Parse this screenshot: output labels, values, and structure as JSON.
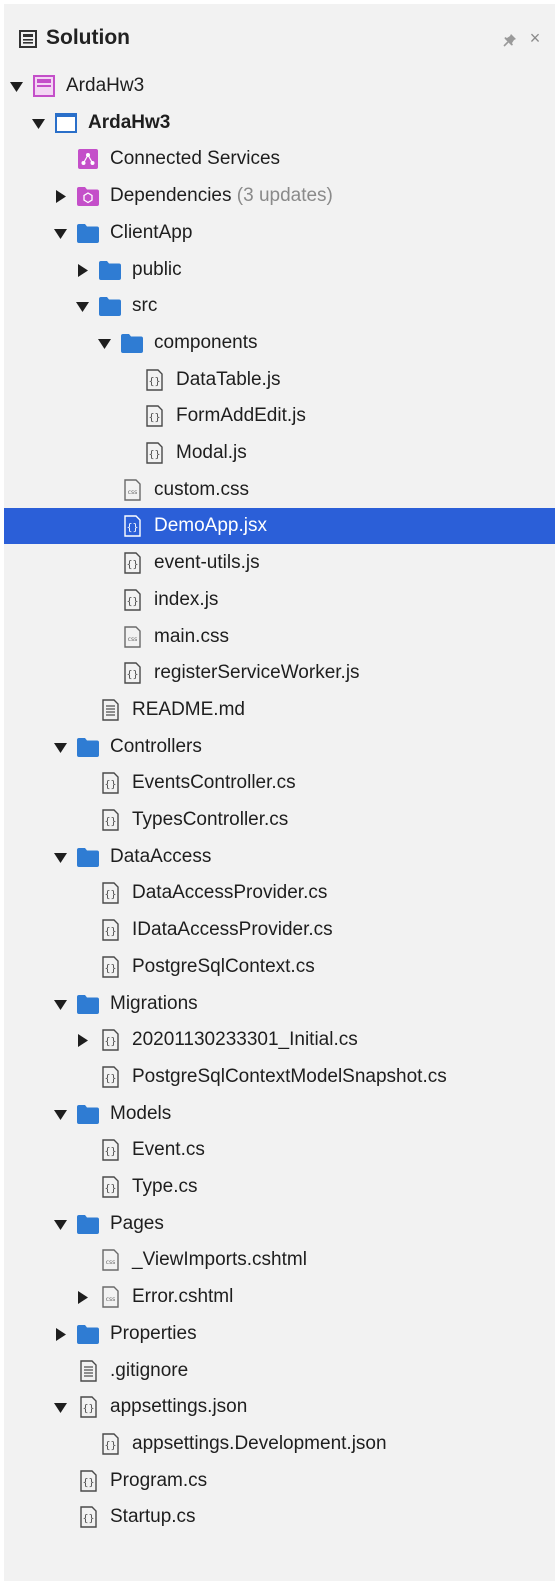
{
  "panel": {
    "title": "Solution",
    "pin_icon": "pin-icon",
    "close_icon": "close-icon",
    "close_glyph": "×"
  },
  "colors": {
    "panel_bg": "#f2f2f2",
    "selection": "#2b5fd8",
    "folder": "#2f7cd3",
    "project": "#c44fc9"
  },
  "tree": [
    {
      "label": "ArdaHw3",
      "icon": "solution",
      "depth": 0,
      "expanded": true,
      "has_children": true
    },
    {
      "label": "ArdaHw3",
      "icon": "project",
      "depth": 1,
      "expanded": true,
      "has_children": true,
      "bold": true
    },
    {
      "label": "Connected Services",
      "icon": "connected-services",
      "depth": 2,
      "has_children": false
    },
    {
      "label": "Dependencies",
      "suffix": "(3 updates)",
      "icon": "dependencies",
      "depth": 2,
      "expanded": false,
      "has_children": true
    },
    {
      "label": "ClientApp",
      "icon": "folder",
      "depth": 2,
      "expanded": true,
      "has_children": true
    },
    {
      "label": "public",
      "icon": "folder",
      "depth": 3,
      "expanded": false,
      "has_children": true
    },
    {
      "label": "src",
      "icon": "folder",
      "depth": 3,
      "expanded": true,
      "has_children": true
    },
    {
      "label": "components",
      "icon": "folder",
      "depth": 4,
      "expanded": true,
      "has_children": true
    },
    {
      "label": "DataTable.js",
      "icon": "code-file",
      "depth": 5,
      "has_children": false
    },
    {
      "label": "FormAddEdit.js",
      "icon": "code-file",
      "depth": 5,
      "has_children": false
    },
    {
      "label": "Modal.js",
      "icon": "code-file",
      "depth": 5,
      "has_children": false
    },
    {
      "label": "custom.css",
      "icon": "css-file",
      "depth": 4,
      "has_children": false
    },
    {
      "label": "DemoApp.jsx",
      "icon": "code-file",
      "depth": 4,
      "has_children": false,
      "selected": true
    },
    {
      "label": "event-utils.js",
      "icon": "code-file",
      "depth": 4,
      "has_children": false
    },
    {
      "label": "index.js",
      "icon": "code-file",
      "depth": 4,
      "has_children": false
    },
    {
      "label": "main.css",
      "icon": "css-file",
      "depth": 4,
      "has_children": false
    },
    {
      "label": "registerServiceWorker.js",
      "icon": "code-file",
      "depth": 4,
      "has_children": false
    },
    {
      "label": "README.md",
      "icon": "text-file",
      "depth": 3,
      "has_children": false
    },
    {
      "label": "Controllers",
      "icon": "folder",
      "depth": 2,
      "expanded": true,
      "has_children": true
    },
    {
      "label": "EventsController.cs",
      "icon": "code-file",
      "depth": 3,
      "has_children": false
    },
    {
      "label": "TypesController.cs",
      "icon": "code-file",
      "depth": 3,
      "has_children": false
    },
    {
      "label": "DataAccess",
      "icon": "folder",
      "depth": 2,
      "expanded": true,
      "has_children": true
    },
    {
      "label": "DataAccessProvider.cs",
      "icon": "code-file",
      "depth": 3,
      "has_children": false
    },
    {
      "label": "IDataAccessProvider.cs",
      "icon": "code-file",
      "depth": 3,
      "has_children": false
    },
    {
      "label": "PostgreSqlContext.cs",
      "icon": "code-file",
      "depth": 3,
      "has_children": false
    },
    {
      "label": "Migrations",
      "icon": "folder",
      "depth": 2,
      "expanded": true,
      "has_children": true
    },
    {
      "label": "20201130233301_Initial.cs",
      "icon": "code-file",
      "depth": 3,
      "expanded": false,
      "has_children": true
    },
    {
      "label": "PostgreSqlContextModelSnapshot.cs",
      "icon": "code-file",
      "depth": 3,
      "has_children": false
    },
    {
      "label": "Models",
      "icon": "folder",
      "depth": 2,
      "expanded": true,
      "has_children": true
    },
    {
      "label": "Event.cs",
      "icon": "code-file",
      "depth": 3,
      "has_children": false
    },
    {
      "label": "Type.cs",
      "icon": "code-file",
      "depth": 3,
      "has_children": false
    },
    {
      "label": "Pages",
      "icon": "folder",
      "depth": 2,
      "expanded": true,
      "has_children": true
    },
    {
      "label": "_ViewImports.cshtml",
      "icon": "css-file",
      "depth": 3,
      "has_children": false
    },
    {
      "label": "Error.cshtml",
      "icon": "css-file",
      "depth": 3,
      "expanded": false,
      "has_children": true
    },
    {
      "label": "Properties",
      "icon": "folder",
      "depth": 2,
      "expanded": false,
      "has_children": true
    },
    {
      "label": ".gitignore",
      "icon": "text-file",
      "depth": 2,
      "has_children": false
    },
    {
      "label": "appsettings.json",
      "icon": "code-file",
      "depth": 2,
      "expanded": true,
      "has_children": true
    },
    {
      "label": "appsettings.Development.json",
      "icon": "code-file",
      "depth": 3,
      "has_children": false
    },
    {
      "label": "Program.cs",
      "icon": "code-file",
      "depth": 2,
      "has_children": false
    },
    {
      "label": "Startup.cs",
      "icon": "code-file",
      "depth": 2,
      "has_children": false
    }
  ]
}
